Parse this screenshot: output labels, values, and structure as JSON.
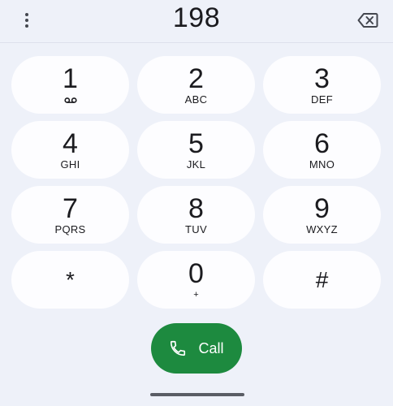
{
  "display": {
    "number": "198"
  },
  "icons": {
    "menu": "more-vert-icon",
    "backspace": "backspace-icon",
    "voicemail": "voicemail-icon",
    "call": "phone-icon"
  },
  "keypad": {
    "keys": [
      {
        "digit": "1",
        "letters": ""
      },
      {
        "digit": "2",
        "letters": "ABC"
      },
      {
        "digit": "3",
        "letters": "DEF"
      },
      {
        "digit": "4",
        "letters": "GHI"
      },
      {
        "digit": "5",
        "letters": "JKL"
      },
      {
        "digit": "6",
        "letters": "MNO"
      },
      {
        "digit": "7",
        "letters": "PQRS"
      },
      {
        "digit": "8",
        "letters": "TUV"
      },
      {
        "digit": "9",
        "letters": "WXYZ"
      },
      {
        "digit": "*",
        "letters": ""
      },
      {
        "digit": "0",
        "letters": "+"
      },
      {
        "digit": "#",
        "letters": ""
      }
    ]
  },
  "call_button": {
    "label": "Call"
  },
  "colors": {
    "background": "#eef1f9",
    "key_background": "#fdfdff",
    "call_green": "#1d8a3f"
  }
}
